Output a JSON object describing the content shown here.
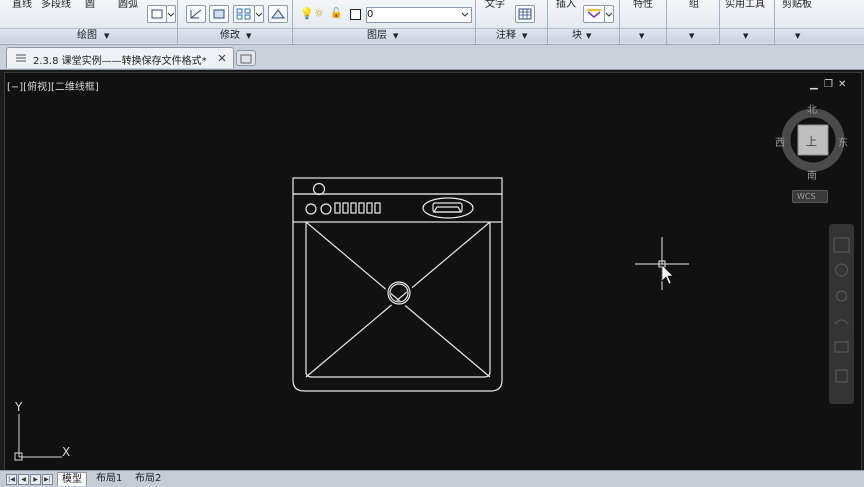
{
  "ribbon": {
    "draw_tools": {
      "line": "直线",
      "polyline": "多段线",
      "circle": "圆",
      "arc": "圆弧"
    },
    "layer_value": "0",
    "insert_label": "插入",
    "text_label": "文字",
    "properties_label": "特性",
    "group_label": "组",
    "utilities_label": "实用工具",
    "clipboard_label": "剪贴板",
    "panels": {
      "draw": "绘图",
      "modify": "修改",
      "layers": "图层",
      "annotation": "注释",
      "block": "块"
    }
  },
  "doc_tab": {
    "title": "2.3.8 课堂实例——转换保存文件格式*"
  },
  "viewport": {
    "label": "[−][俯视][二维线框]"
  },
  "viewcube": {
    "north": "北",
    "south": "南",
    "east": "东",
    "west": "西",
    "top": "上",
    "wcs": "WCS"
  },
  "ucs": {
    "x": "X",
    "y": "Y"
  },
  "layout_tabs": [
    "模型",
    "布局1",
    "布局2"
  ]
}
